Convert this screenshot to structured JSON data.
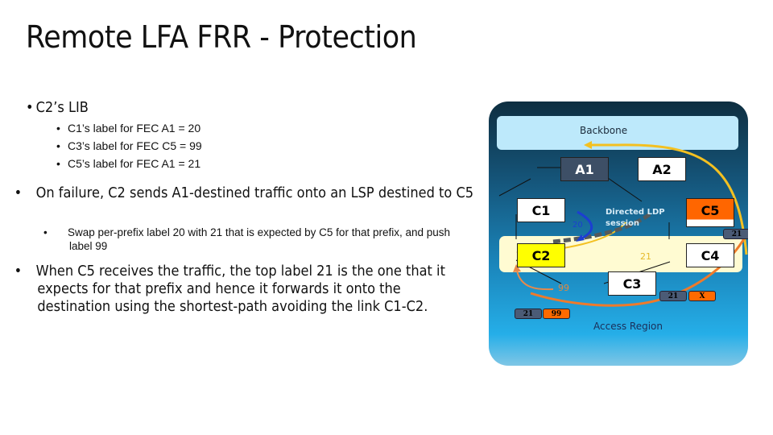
{
  "slide": {
    "title": "Remote LFA FRR - Protection",
    "bullets": {
      "lib_heading": "C2’s LIB",
      "lib_items": [
        "C1’s label for FEC A1 = 20",
        "C3’s label for FEC C5 = 99",
        "C5’s label for FEC A1 = 21"
      ],
      "failure": "On failure, C2 sends A1-destined traffic onto an LSP destined to C5",
      "failure_sub": "Swap per-prefix label 20 with 21 that is expected by C5 for that prefix, and push label 99",
      "receive": "When C5 receives the traffic, the top label 21 is the one that it expects for that prefix and hence it forwards it onto the destination using the shortest-path avoiding the link C1-C2."
    },
    "bullet_char": "•"
  },
  "diagram": {
    "regions": {
      "backbone": "Backbone",
      "access": "Access Region"
    },
    "nodes": {
      "a1": "A1",
      "a2": "A2",
      "c1": "C1",
      "c2": "C2",
      "c3": "C3",
      "c4": "C4",
      "c5": "C5"
    },
    "session_label": "Directed LDP session",
    "path_labels": {
      "blue": "20",
      "yellow": "21",
      "orange": "99"
    },
    "label_stacks": {
      "at_c2": [
        "21",
        "99"
      ],
      "at_c3": [
        "21",
        "X"
      ],
      "at_c5": [
        "21"
      ]
    },
    "colors": {
      "c2_fill": "#ffff00",
      "c5_fill": "#ff6600",
      "a1_fill": "#3d4f66",
      "yellow_path": "#f3c021",
      "orange_path": "#ef7a2a",
      "blue_path": "#1c3fd1",
      "tag_dark": "#4b5b76",
      "tag_orange": "#ff6a00"
    }
  }
}
